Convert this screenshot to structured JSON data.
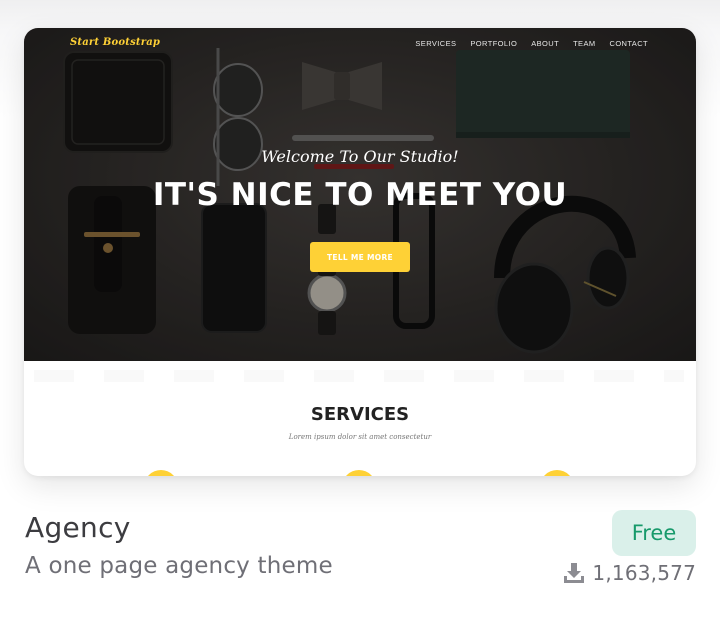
{
  "preview": {
    "brand": "Start Bootstrap",
    "nav": [
      "SERVICES",
      "PORTFOLIO",
      "ABOUT",
      "TEAM",
      "CONTACT"
    ],
    "welcome": "Welcome To Our Studio!",
    "headline": "IT'S NICE TO MEET YOU",
    "cta": "TELL ME MORE",
    "section_title": "SERVICES",
    "section_subtitle": "Lorem ipsum dolor sit amet consectetur"
  },
  "theme": {
    "title": "Agency",
    "description": "A one page agency theme",
    "price_badge": "Free",
    "downloads": "1,163,577",
    "download_icon": "download-icon"
  },
  "colors": {
    "accent_yellow": "#fed136",
    "badge_bg": "#daf0ea",
    "badge_text": "#179a6b",
    "title_text": "#3c3c40",
    "muted_text": "#6f6f76"
  }
}
